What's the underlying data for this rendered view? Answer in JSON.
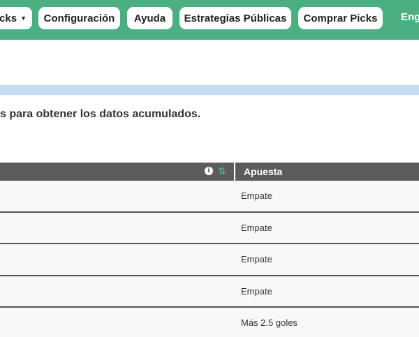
{
  "nav": {
    "picks_label": "cks",
    "config_label": "Configuración",
    "ayuda_label": "Ayuda",
    "estrategias_label": "Estrategias Públicas",
    "comprar_label": "Comprar Picks",
    "lang_label": "Eng"
  },
  "notice": "s para obtener los datos acumulados.",
  "table": {
    "header_apuesta": "Apuesta",
    "info_icon": "info-icon",
    "sort_icon": "sort-icon",
    "rows": [
      {
        "apuesta": "Empate"
      },
      {
        "apuesta": "Empate"
      },
      {
        "apuesta": "Empate"
      },
      {
        "apuesta": "Empate"
      },
      {
        "apuesta": "Más 2.5 goles"
      }
    ]
  },
  "colors": {
    "navbar": "#4caf82",
    "info_strip": "#c7dcf2",
    "table_header": "#5c5c5c",
    "row_bg": "#f7f8fa"
  }
}
